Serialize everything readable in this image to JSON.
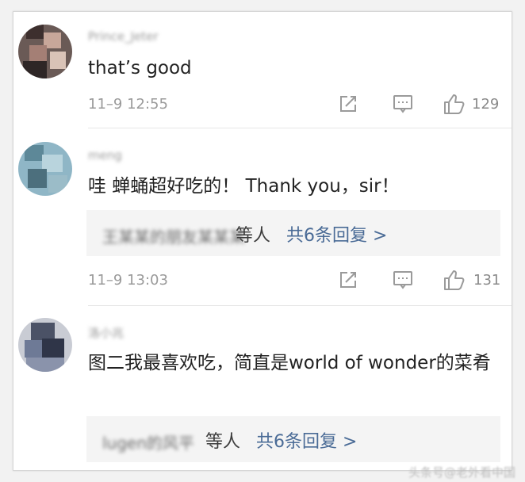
{
  "colors": {
    "link": "#4a6b96",
    "muted": "#9a9a9a",
    "text": "#222222",
    "reply_bg": "#f4f4f4"
  },
  "comments": [
    {
      "username": "Prince_Jeter",
      "text": "that’s good",
      "time": "11–9 12:55",
      "likes": "129",
      "icons": [
        "share-icon",
        "comment-icon",
        "thumbs-up-icon"
      ]
    },
    {
      "username": "meng",
      "text": "哇 蝉蛹超好吃的！ Thank you，sir！",
      "reply_names": "王某某的朋友某某某",
      "reply_suffix": "等人",
      "reply_count": "共6条回复 >",
      "time": "11–9 13:03",
      "likes": "131"
    },
    {
      "username": "洛小兆",
      "text": "图二我最喜欢吃，简直是world of wonder的菜肴",
      "reply_names": "lugen的风平",
      "reply_suffix": "等人",
      "reply_count": "共6条回复 >"
    }
  ],
  "watermark": "头条号@老外看中国"
}
